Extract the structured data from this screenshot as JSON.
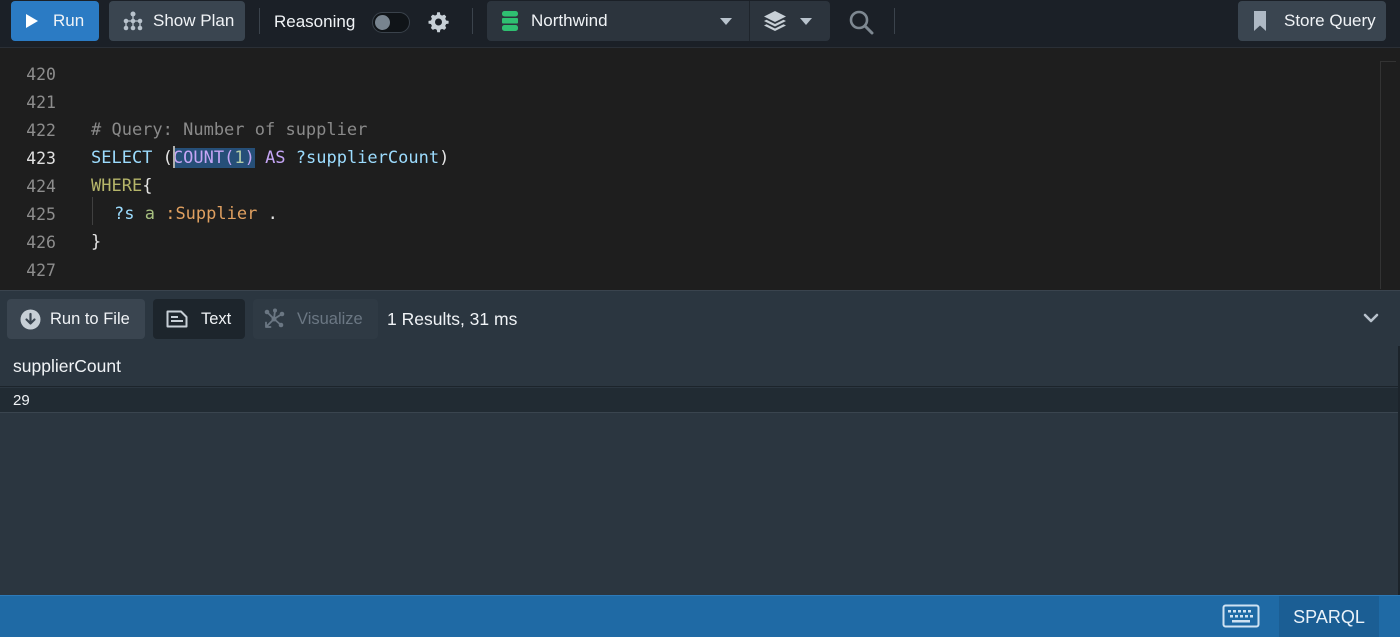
{
  "toolbar": {
    "run_label": "Run",
    "show_plan_label": "Show Plan",
    "reasoning_label": "Reasoning",
    "reasoning_enabled": false,
    "database": "Northwind",
    "store_query_label": "Store Query",
    "icons": {
      "run": "play-icon",
      "show_plan": "hierarchy-icon",
      "settings": "gear-icon",
      "database": "database-icon",
      "layers": "layers-icon",
      "search": "search-icon",
      "store_query": "bookmark-icon"
    },
    "colors": {
      "run_button": "#2b7bc4",
      "database_icon": "#2fbf71"
    }
  },
  "editor": {
    "current_line": "423",
    "lines": [
      {
        "number": "420",
        "text": ""
      },
      {
        "number": "421",
        "text": ""
      },
      {
        "number": "422",
        "text": "# Query: Number of supplier"
      },
      {
        "number": "423",
        "text": "SELECT (COUNT(1) AS ?supplierCount)"
      },
      {
        "number": "424",
        "text": "WHERE{"
      },
      {
        "number": "425",
        "text": "  ?s a :Supplier ."
      },
      {
        "number": "426",
        "text": "}"
      },
      {
        "number": "427",
        "text": ""
      }
    ],
    "tokens": {
      "comment": "# Query: Number of supplier",
      "select": "SELECT",
      "open_paren": " (",
      "count_fn": "COUNT(",
      "count_arg": "1",
      "count_close": ")",
      "as": " AS ",
      "alias": "?supplierCount",
      "close_paren": ")",
      "where": "WHERE",
      "open_brace": "{",
      "subject": "?s",
      "predicate": " a ",
      "class": ":Supplier",
      "dot": " .",
      "close_brace": "}"
    },
    "selection": "COUNT(1)"
  },
  "results": {
    "run_to_file_label": "Run to File",
    "text_label": "Text",
    "visualize_label": "Visualize",
    "summary": "1 Results,  31 ms",
    "columns": [
      "supplierCount"
    ],
    "rows": [
      [
        "29"
      ]
    ]
  },
  "statusbar": {
    "language": "SPARQL",
    "keyboard_icon": "keyboard-icon"
  }
}
